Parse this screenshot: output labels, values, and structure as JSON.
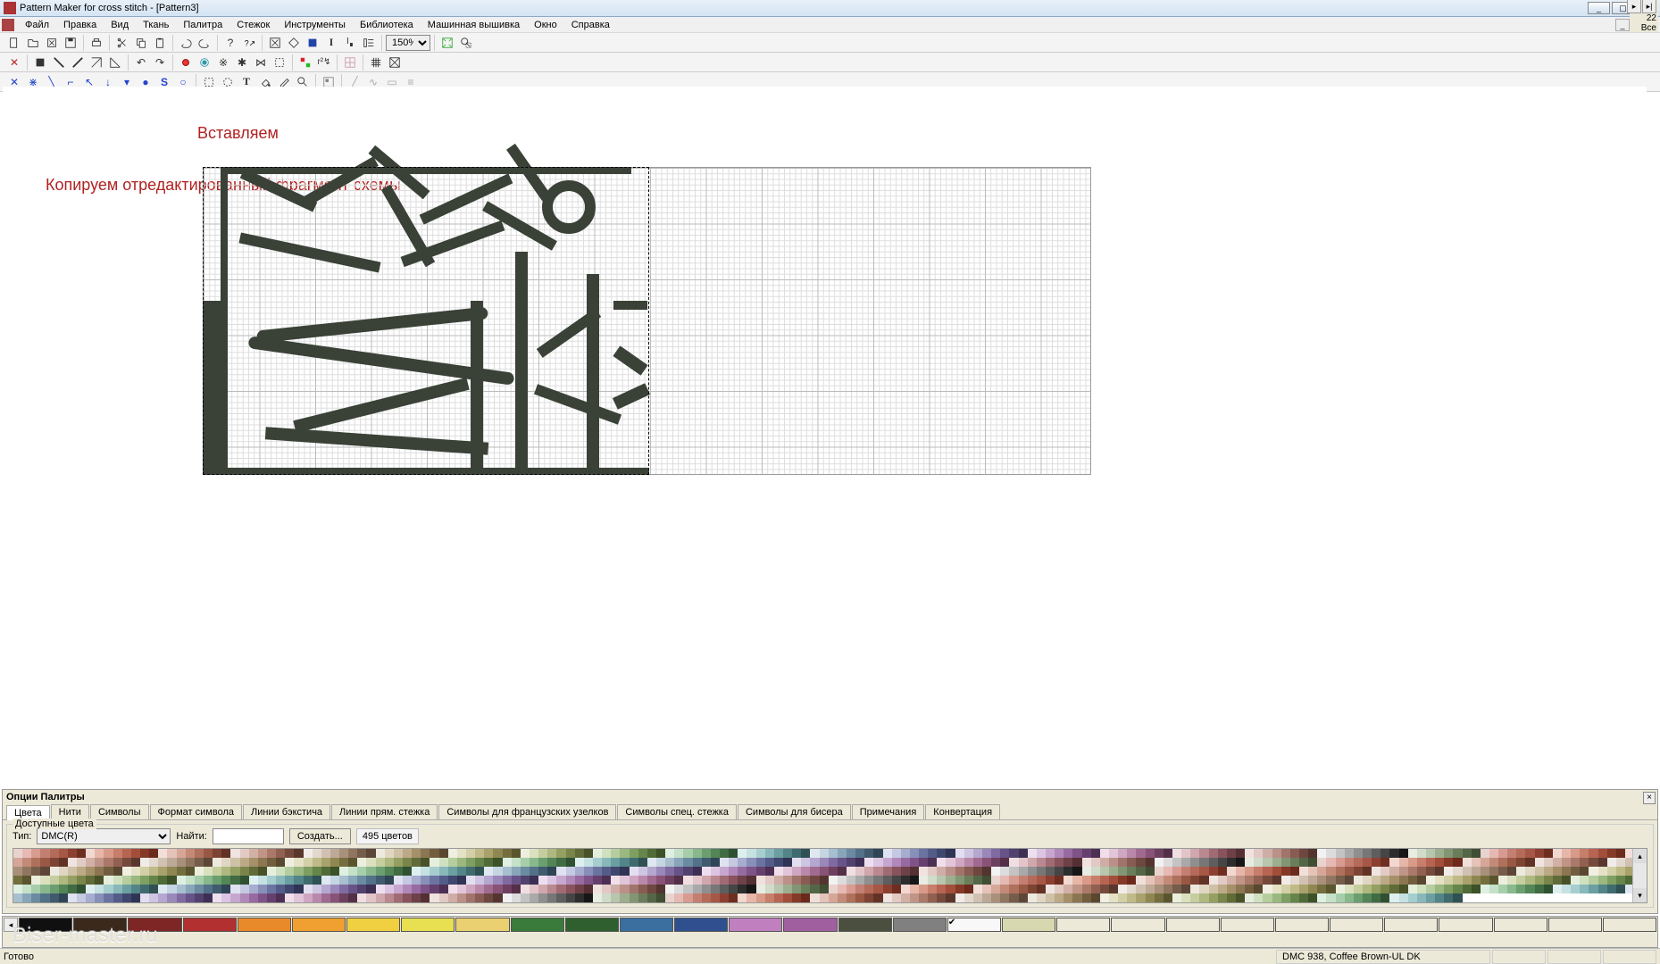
{
  "window": {
    "title": "Pattern Maker for cross stitch - [Pattern3]"
  },
  "menu": {
    "items": [
      "Файл",
      "Правка",
      "Вид",
      "Ткань",
      "Палитра",
      "Стежок",
      "Инструменты",
      "Библиотека",
      "Машинная вышивка",
      "Окно",
      "Справка"
    ]
  },
  "toolbar1": {
    "zoom_value": "150%"
  },
  "annotations": {
    "paste": "Вставляем",
    "copy": "Копируем отредактированный фрагмент схемы"
  },
  "palette": {
    "title": "Опции Палитры",
    "tabs": [
      "Цвета",
      "Нити",
      "Символы",
      "Формат символа",
      "Линии бэкстича",
      "Линии прям. стежка",
      "Символы для французских узелков",
      "Символы спец. стежка",
      "Символы для бисера",
      "Примечания",
      "Конвертация"
    ],
    "active_tab": 0,
    "groupbox": "Доступные цвета",
    "type_label": "Тип:",
    "type_value": "DMC(R)",
    "find_label": "Найти:",
    "find_value": "",
    "create_btn": "Создать...",
    "count": "495 цветов"
  },
  "colorbar": {
    "labels": [
      "22",
      "Все"
    ],
    "slots": [
      "#101010",
      "#3b2a1c",
      "#7e2626",
      "#b23030",
      "#e98a2a",
      "#f0a030",
      "#f0d040",
      "#e8e050",
      "#ead070",
      "#3a7a3a",
      "#2f5f2f",
      "#3a6fa0",
      "#2f4f8f",
      "#c080c0",
      "#a060a0",
      "#4a4f3f",
      "#808080",
      "#f8f8f8",
      "#d8d8b0",
      "",
      "",
      "",
      "",
      "",
      "",
      "",
      "",
      "",
      "",
      ""
    ]
  },
  "status": {
    "left": "Готово",
    "right": "DMC  938, Coffee Brown-UL DK"
  },
  "watermark": "Biser-master.ru",
  "available_colors_seed": [
    "#e9d3cf",
    "#e7b9b4",
    "#d89b92",
    "#c47f73",
    "#b56b5a",
    "#a75746",
    "#8d4031",
    "#6d2e21",
    "#f2d8d0",
    "#e6b6a8",
    "#d89a89",
    "#c77e6a",
    "#b76552",
    "#a24e3b",
    "#853927",
    "#6b2a1c",
    "#f1e0d9",
    "#e5c3b8",
    "#d6a799",
    "#c38a78",
    "#af705c",
    "#995844",
    "#7e4433",
    "#623225",
    "#efe4e0",
    "#e2cbc4",
    "#d2b0a6",
    "#c09588",
    "#aa796a",
    "#916051",
    "#754a3d",
    "#5a372d",
    "#f1ece7",
    "#e3d8ce",
    "#d1c1b3",
    "#bea997",
    "#a8907b",
    "#907661",
    "#755d4a",
    "#5b4637",
    "#eee9de",
    "#e0d6c3",
    "#cfc1a6",
    "#bcaa87",
    "#a5906a",
    "#8c7652",
    "#725e3f",
    "#59472f",
    "#f0efe1",
    "#e4e1c5",
    "#d3cfa7",
    "#c0ba88",
    "#a9a26c",
    "#8f8752",
    "#746e3e",
    "#5a552e",
    "#ecefdd",
    "#dbe1bf",
    "#c6ce9f",
    "#aeb87f",
    "#949f62",
    "#79854a",
    "#606b37",
    "#485127",
    "#e6efdd",
    "#d0e1c0",
    "#b6ce9f",
    "#9ab87f",
    "#7f9f62",
    "#66854a",
    "#506b37",
    "#3c5127",
    "#dfefe1",
    "#c5e1c8",
    "#a7ceab",
    "#88b88c",
    "#6b9f70",
    "#538557",
    "#406b43",
    "#2f5131",
    "#dfeff0",
    "#c5e1e2",
    "#a7cecf",
    "#88b8ba",
    "#6b9fa1",
    "#538588",
    "#406b6e",
    "#2f5154",
    "#dfe8f0",
    "#c5d5e2",
    "#a7bfcf",
    "#88a5ba",
    "#6b8ba1",
    "#537188",
    "#405a6e",
    "#2f4454",
    "#dfe2f0",
    "#c5c9e2",
    "#a7adcf",
    "#8890ba",
    "#6b74a1",
    "#535c88",
    "#40476e",
    "#2f3454",
    "#e4dff0",
    "#cec5e2",
    "#b5a7cf",
    "#9a88ba",
    "#806ba1",
    "#685388",
    "#52406e",
    "#3d2f54",
    "#eddff0",
    "#dcc5e2",
    "#c7a7cf",
    "#b088ba",
    "#976ba1",
    "#7e5388",
    "#65406e",
    "#4d2f54",
    "#f0dfeb",
    "#e2c5d9",
    "#cfa7c3",
    "#ba88ab",
    "#a16b91",
    "#885377",
    "#6e405f",
    "#542f48",
    "#f0dfe2",
    "#e2c5c9",
    "#cfa7ad",
    "#ba8890",
    "#a16b74",
    "#88535c",
    "#6e4047",
    "#542f34",
    "#f0e2df",
    "#e2c9c5",
    "#cfada7",
    "#ba9088",
    "#a1746b",
    "#885c53",
    "#6e4740",
    "#54342f",
    "#f2f2f2",
    "#dcdcdc",
    "#c3c3c3",
    "#a9a9a9",
    "#8f8f8f",
    "#777777",
    "#5e5e5e",
    "#454545",
    "#2d2d2d",
    "#171717",
    "#e8ece2",
    "#d1dbca",
    "#b7c6ad",
    "#9dae8f",
    "#839674",
    "#6b7e5c",
    "#556647",
    "#404e34"
  ]
}
